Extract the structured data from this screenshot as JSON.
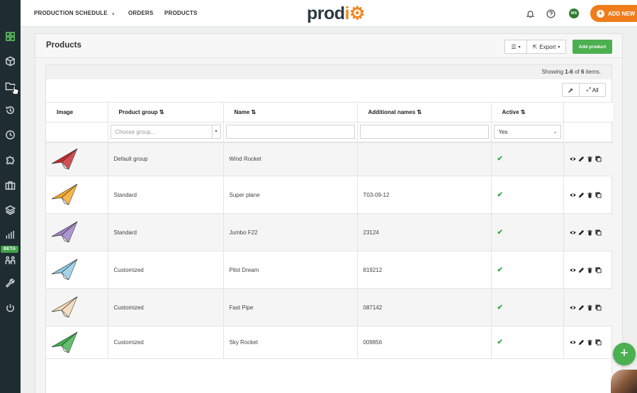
{
  "topnav": {
    "items": [
      "PRODUCTION SCHEDULE",
      "ORDERS",
      "PRODUCTS"
    ],
    "logo": "prodio",
    "user_initials": "MS",
    "add_new_label": "ADD NEW"
  },
  "sidebar": {
    "icons": [
      "dashboard-icon",
      "box-icon",
      "folder-icon",
      "history-icon",
      "clock-icon",
      "puzzle-icon",
      "briefcase-icon",
      "layers-icon",
      "bar-chart-icon",
      "people-icon",
      "wrench-icon",
      "power-icon"
    ],
    "beta_badge": "BETA",
    "accent_color": "#5ec95e"
  },
  "panel": {
    "title": "Products",
    "export_label": "Export",
    "add_product_label": "Add product",
    "showing_prefix": "Showing",
    "showing_range": "1-6",
    "showing_of": "of",
    "showing_total": "6",
    "showing_suffix": "items.",
    "expand_all_label": "All"
  },
  "table": {
    "headers": [
      "Image",
      "Product group",
      "Name",
      "Additional names",
      "Active"
    ],
    "filters": {
      "group_placeholder": "Choose group...",
      "active_value": "Yes"
    },
    "rows": [
      {
        "group": "Default group",
        "name": "Wind Rocket",
        "additional": "",
        "active": "✔",
        "plane_color": "#c6282b"
      },
      {
        "group": "Standard",
        "name": "Super plane",
        "additional": "T03-09-12",
        "active": "✔",
        "plane_color": "#f5a623"
      },
      {
        "group": "Standard",
        "name": "Jumbo F22",
        "additional": "23124",
        "active": "✔",
        "plane_color": "#9a7fc4"
      },
      {
        "group": "Customized",
        "name": "Pilot Dream",
        "additional": "819212",
        "active": "✔",
        "plane_color": "#8ec9e6"
      },
      {
        "group": "Customized",
        "name": "Fast Pipe",
        "additional": "087142",
        "active": "✔",
        "plane_color": "#f3d9b6"
      },
      {
        "group": "Customized",
        "name": "Sky Rocket",
        "additional": "009856",
        "active": "✔",
        "plane_color": "#3bb04a"
      }
    ]
  }
}
